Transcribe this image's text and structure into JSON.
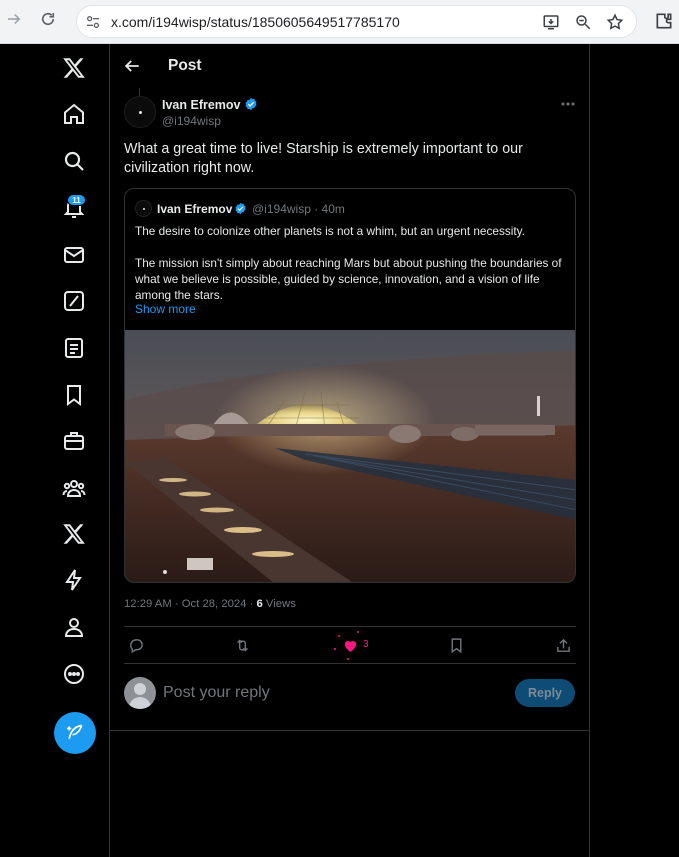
{
  "browser": {
    "url": "x.com/i194wisp/status/1850605649517785170"
  },
  "sidebar": {
    "notifications_badge": "11",
    "items": [
      {
        "icon": "x-logo-icon"
      },
      {
        "icon": "home-icon"
      },
      {
        "icon": "search-icon"
      },
      {
        "icon": "bell-icon"
      },
      {
        "icon": "mail-icon"
      },
      {
        "icon": "grok-icon"
      },
      {
        "icon": "lists-icon"
      },
      {
        "icon": "bookmark-icon"
      },
      {
        "icon": "briefcase-icon"
      },
      {
        "icon": "communities-icon"
      },
      {
        "icon": "x-premium-icon"
      },
      {
        "icon": "lightning-icon"
      },
      {
        "icon": "profile-icon"
      },
      {
        "icon": "more-circle-icon"
      }
    ],
    "compose_icon": "feather-plus-icon"
  },
  "header": {
    "title": "Post"
  },
  "post": {
    "author_name": "Ivan Efremov",
    "author_handle": "@i194wisp",
    "text": "What a great time to live! Starship is extremely important to our civilization right now.",
    "timestamp": "12:29 AM · Oct 28, 2024 · ",
    "views_count": "6",
    "views_label": " Views",
    "likes_count": "3",
    "quote": {
      "author_name": "Ivan Efremov",
      "author_handle_time": "@i194wisp · 40m",
      "paragraph1": "The desire to colonize other planets is not a whim, but an urgent necessity.",
      "paragraph2": "The mission isn't simply about reaching Mars but about pushing the boundaries of what we believe is possible, guided by science, innovation, and a vision of life among the stars.",
      "show_more": "Show more"
    }
  },
  "reply": {
    "placeholder": "Post your reply",
    "button_label": "Reply"
  },
  "colors": {
    "accent": "#1d9bf0",
    "like": "#f91880",
    "background": "#000000",
    "border": "#2f3336",
    "muted_text": "#71767b"
  }
}
